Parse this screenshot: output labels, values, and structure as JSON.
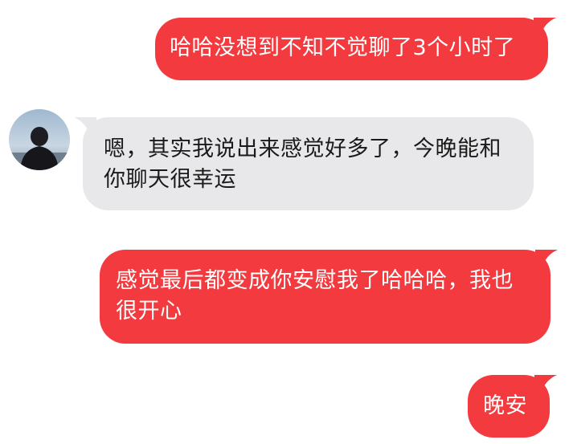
{
  "conversation": {
    "messages": [
      {
        "sender": "me",
        "text": "哈哈没想到不知不觉聊了3个小时了"
      },
      {
        "sender": "contact",
        "text": "嗯，其实我说出来感觉好多了，今晚能和你聊天很幸运"
      },
      {
        "sender": "me",
        "text": "感觉最后都变成你安慰我了哈哈哈，我也很开心"
      },
      {
        "sender": "me",
        "text": "晚安"
      }
    ]
  },
  "colors": {
    "outgoing_bubble": "#f23a3f",
    "incoming_bubble": "#e8e8ea",
    "outgoing_text": "#ffffff",
    "incoming_text": "#1a1a1a"
  },
  "contact": {
    "avatar_icon": "person-silhouette-avatar"
  }
}
